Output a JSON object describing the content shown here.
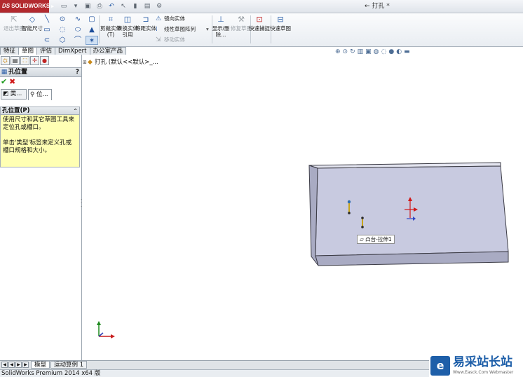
{
  "app": {
    "brand": "SOLIDWORKS",
    "brand_prefix": "DS",
    "document_title": "← 打孔 *",
    "quick_access_icons": [
      "new-icon",
      "open-icon",
      "save-icon",
      "print-icon",
      "undo-icon",
      "select-icon",
      "rebuild-icon",
      "file-props-icon",
      "options-icon"
    ]
  },
  "command_manager": {
    "exit_sketch": "退出草图",
    "smart_dimension": "智能尺寸",
    "trim_entities": "剪裁实体(T)",
    "convert_entities": "转换实体引用",
    "offset_entities": "等距实体",
    "mirror_entities": "镜向实体",
    "linear_pattern": "线性草图阵列",
    "move_entities": "移动实体",
    "display_delete_relations": "显示/删除...",
    "repair_sketch": "修复草图",
    "quick_snaps": "快速捕捉",
    "rapid_sketch": "快速草图"
  },
  "tabs": [
    "特征",
    "草图",
    "评估",
    "DimXpert",
    "办公室产品"
  ],
  "active_tab": 1,
  "property_manager": {
    "title": "孔位置",
    "help": "?",
    "ok_icon": "✔",
    "cancel_icon": "✖",
    "type_tab": "类...",
    "position_tab": "位...",
    "group_title": "孔位置(P)",
    "help_text_1": "使用尺寸和其它草图工具来定位孔或槽口。",
    "help_text_2": "单击'类型'标签来定义孔或槽口规格和大小。"
  },
  "feature_tree": {
    "root_label": "打孔 (默认<<默认>_..."
  },
  "viewport": {
    "tooltip": "凸台-拉伸1",
    "plate_color": "#c8cae0",
    "plate_side_color": "#a9abc3"
  },
  "bottom_tabs": [
    "模型",
    "运动算例 1"
  ],
  "status": {
    "text": "SolidWorks Premium 2014 x64 版"
  },
  "watermark": {
    "title": "易采站长站",
    "url": "Www.Easck.Com Webmaster"
  }
}
